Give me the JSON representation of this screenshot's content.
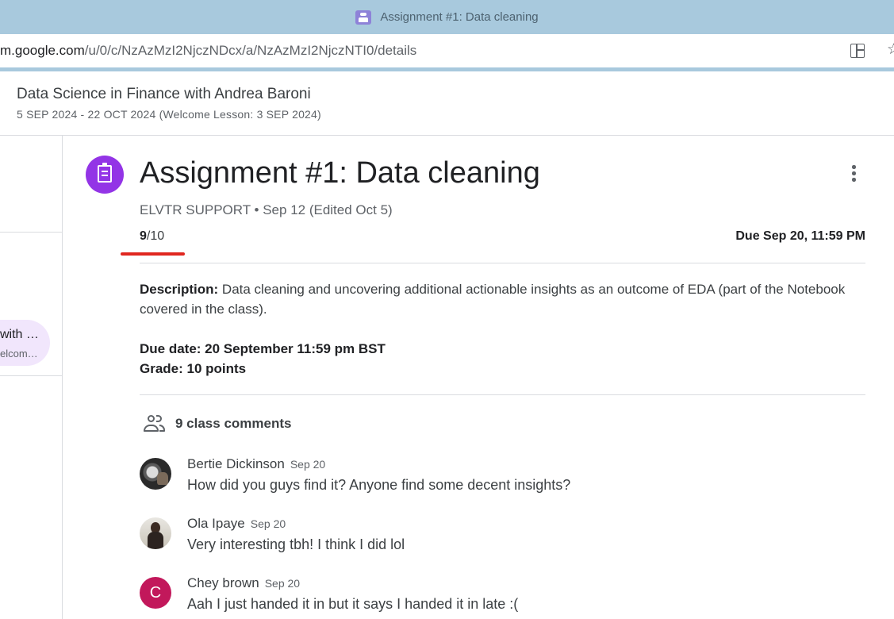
{
  "window": {
    "tab_title": "Assignment #1: Data cleaning"
  },
  "address_bar": {
    "url_host": "m.google.com",
    "url_path": "/u/0/c/NzAzMzI2NjczNDcx/a/NzAzMzI2NjczNTI0/details"
  },
  "class_header": {
    "title": "Data Science in Finance with Andrea Baroni",
    "dates": "5 SEP 2024 - 22 OCT 2024 (Welcome Lesson: 3 SEP 2024)"
  },
  "sidebar": {
    "chip_title": "with …",
    "chip_subtitle": "elcom…"
  },
  "assignment": {
    "title": "Assignment #1: Data cleaning",
    "meta": "ELVTR SUPPORT • Sep 12 (Edited Oct 5)",
    "grade_score": "9",
    "grade_total": "/10",
    "due": "Due Sep 20, 11:59 PM",
    "description_label": "Description:",
    "description_text": " Data cleaning and uncovering additional actionable insights as an outcome of EDA (part of the Notebook covered in the class).",
    "due_date_line": "Due date: 20 September 11:59 pm BST",
    "grade_line": "Grade: 10 points"
  },
  "comments": {
    "count_label": "9 class comments",
    "items": [
      {
        "author": "Bertie Dickinson",
        "date": "Sep 20",
        "text": "How did you guys find it? Anyone find some decent insights?",
        "avatar": "photo"
      },
      {
        "author": "Ola Ipaye",
        "date": "Sep 20",
        "text": "Very interesting tbh! I think I did lol",
        "avatar": "photo"
      },
      {
        "author": "Chey brown",
        "date": "Sep 20",
        "text": "Aah I just handed it in but it says I handed it in late :(",
        "avatar_letter": "C",
        "avatar_color": "#c2185b"
      }
    ]
  },
  "colors": {
    "assignment_icon": "#9334e6",
    "grade_underline": "#e0261f",
    "titlebar": "#a8c9dd"
  },
  "icons": [
    "assignment-icon",
    "more-vert-icon",
    "people-icon",
    "split-screen-icon",
    "star-icon",
    "back-arrow-icon"
  ]
}
